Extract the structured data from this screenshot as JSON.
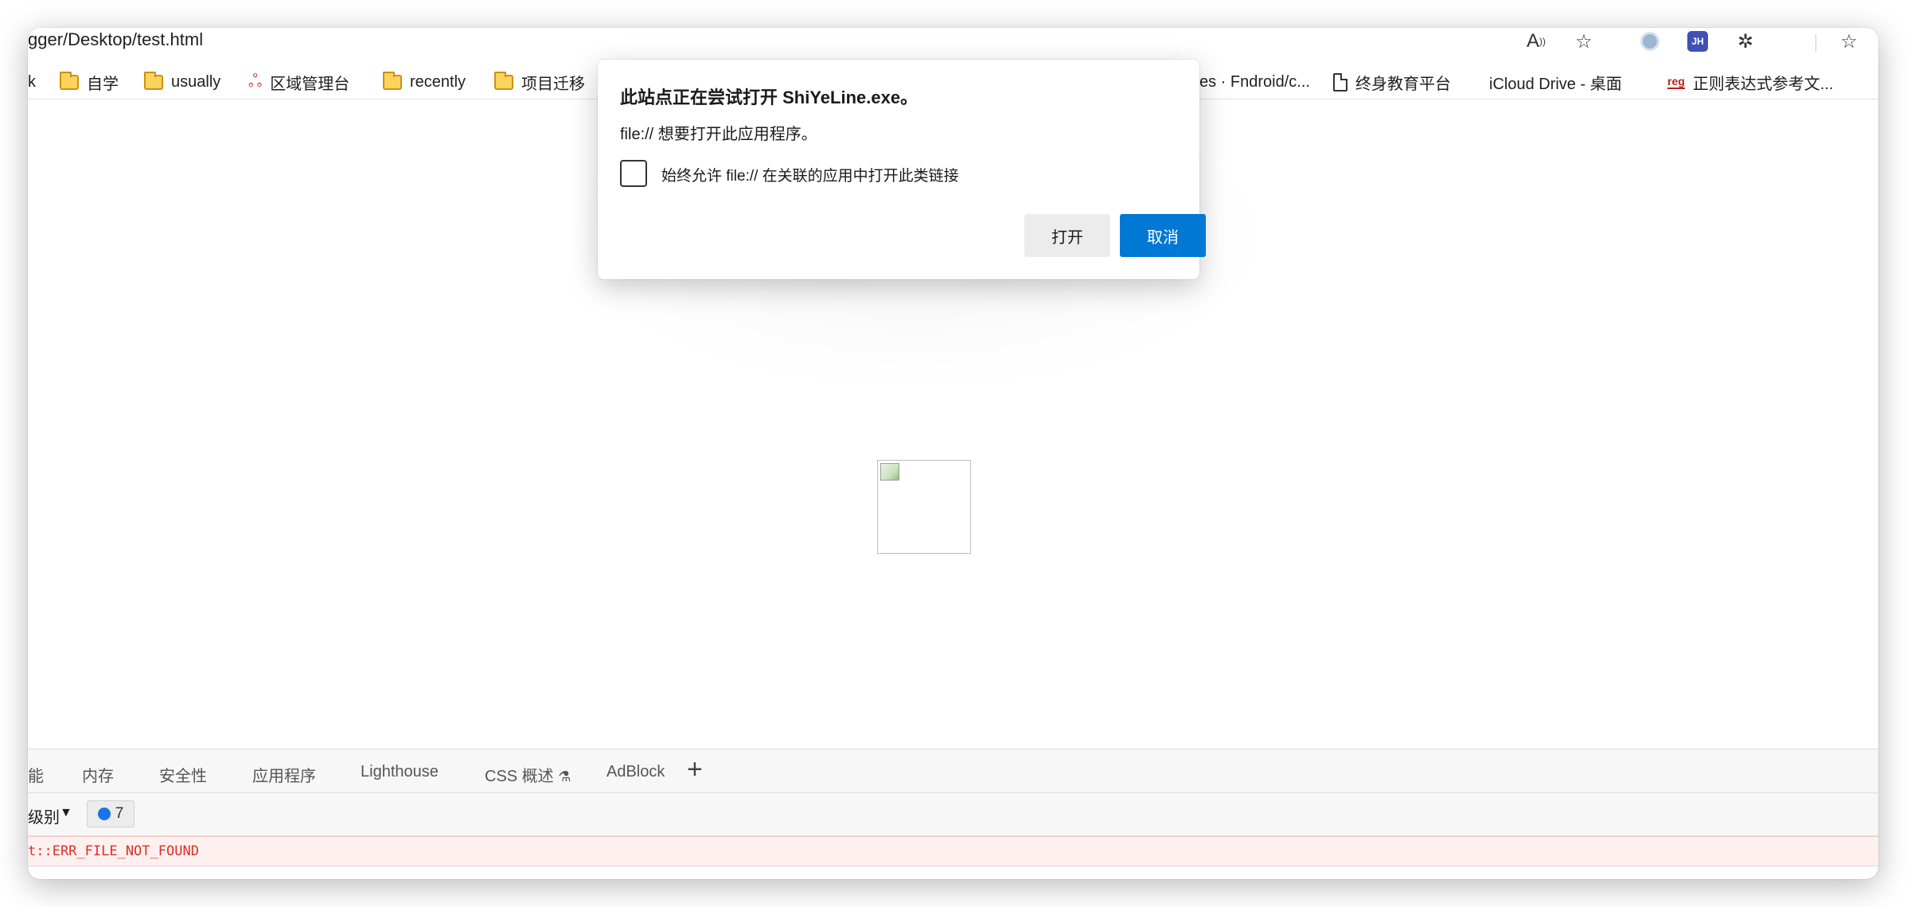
{
  "address_bar": {
    "url": "gger/Desktop/test.html",
    "icons": [
      "read-aloud-icon",
      "favorite-add-icon",
      "profile-circle-icon",
      "jh-extension-icon",
      "extensions-icon",
      "favorites-icon"
    ],
    "jh_label": "JH"
  },
  "bookmarks": {
    "items": [
      {
        "label": "k",
        "icon": "none"
      },
      {
        "label": "自学",
        "icon": "folder-icon"
      },
      {
        "label": "usually",
        "icon": "folder-icon"
      },
      {
        "label": "区域管理台",
        "icon": "app-icon"
      },
      {
        "label": "recently",
        "icon": "folder-icon"
      },
      {
        "label": "项目迁移",
        "icon": "folder-icon"
      },
      {
        "label": "es · Fndroid/c...",
        "icon": "none"
      },
      {
        "label": "终身教育平台",
        "icon": "page-icon"
      },
      {
        "label": "iCloud Drive - 桌面",
        "icon": "apple-icon"
      },
      {
        "label": "正则表达式参考文...",
        "icon": "regex-icon"
      }
    ]
  },
  "dialog": {
    "title": "此站点正在尝试打开 ShiYeLine.exe。",
    "message": "file:// 想要打开此应用程序。",
    "checkbox_label": "始终允许 file:// 在关联的应用中打开此类链接",
    "checkbox_checked": false,
    "open_label": "打开",
    "cancel_label": "取消",
    "accent_color": "#0078d4"
  },
  "devtools": {
    "tabs": [
      {
        "label": "能"
      },
      {
        "label": "内存"
      },
      {
        "label": "安全性"
      },
      {
        "label": "应用程序"
      },
      {
        "label": "Lighthouse"
      },
      {
        "label": "CSS 概述"
      },
      {
        "label": "AdBlock"
      }
    ],
    "add_tab_label": "+",
    "levels_label": "级别",
    "issues_count": "7",
    "error_text": "t::ERR_FILE_NOT_FOUND",
    "error_color": "#d93025"
  }
}
